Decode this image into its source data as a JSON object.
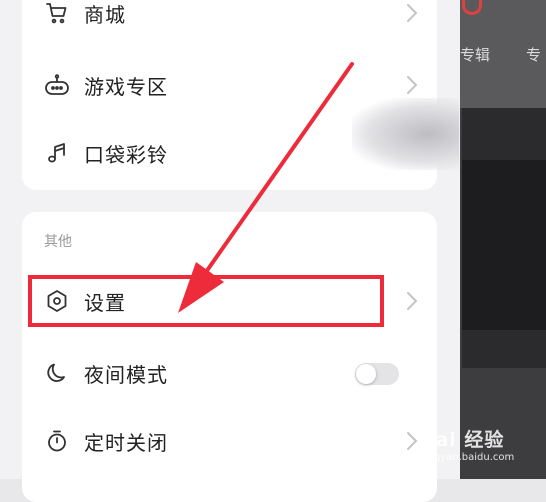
{
  "background": {
    "tabs": [
      "专辑",
      "专"
    ]
  },
  "menu_top": {
    "items": [
      {
        "label": "商城",
        "icon": "cart-icon"
      },
      {
        "label": "游戏专区",
        "icon": "gamepad-icon"
      },
      {
        "label": "口袋彩铃",
        "icon": "ringtone-icon"
      }
    ]
  },
  "menu_other": {
    "section_title": "其他",
    "items": [
      {
        "label": "设置",
        "icon": "hexagon-settings-icon"
      },
      {
        "label": "夜间模式",
        "icon": "moon-icon",
        "toggle_on": false
      },
      {
        "label": "定时关闭",
        "icon": "timer-icon"
      }
    ]
  },
  "annotation": {
    "highlight_color": "#ee2b3b"
  },
  "watermark": {
    "main": "Bai 经验",
    "sub": "jingyan.baidu.com"
  }
}
